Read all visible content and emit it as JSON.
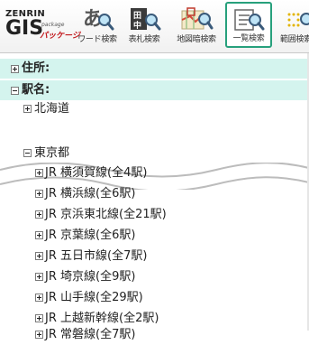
{
  "logo": {
    "brand": "ZENRIN",
    "product": "GIS",
    "package_en": "package",
    "package_jp": "パッケージ"
  },
  "toolbar": {
    "buttons": [
      {
        "label": "ワード検索",
        "icon": "word-search-icon"
      },
      {
        "label": "表札検索",
        "icon": "nameplate-search-icon"
      },
      {
        "label": "地図暗検索",
        "icon": "map-search-icon"
      },
      {
        "label": "一覧検索",
        "icon": "list-search-icon",
        "active": true
      },
      {
        "label": "範囲検索",
        "icon": "range-search-icon"
      }
    ],
    "active_color": "#27a07c"
  },
  "tree": {
    "groups": [
      {
        "label": "住所:",
        "expanded": false
      },
      {
        "label": "駅名:",
        "expanded": true
      }
    ],
    "region_hokkaido": "北海道",
    "region_tokyo": "東京都",
    "lines": [
      "JR 横須賀線(全4駅)",
      "JR 横浜線(全6駅)",
      "JR 京浜東北線(全21駅)",
      "JR 京葉線(全6駅)",
      "JR 五日市線(全7駅)",
      "JR 埼京線(全9駅)",
      "JR 山手線(全29駅)",
      "JR 上越新幹線(全2駅)",
      "JR 常磐線(全7駅)"
    ],
    "group_highlight_color": "#d4f4ee"
  }
}
